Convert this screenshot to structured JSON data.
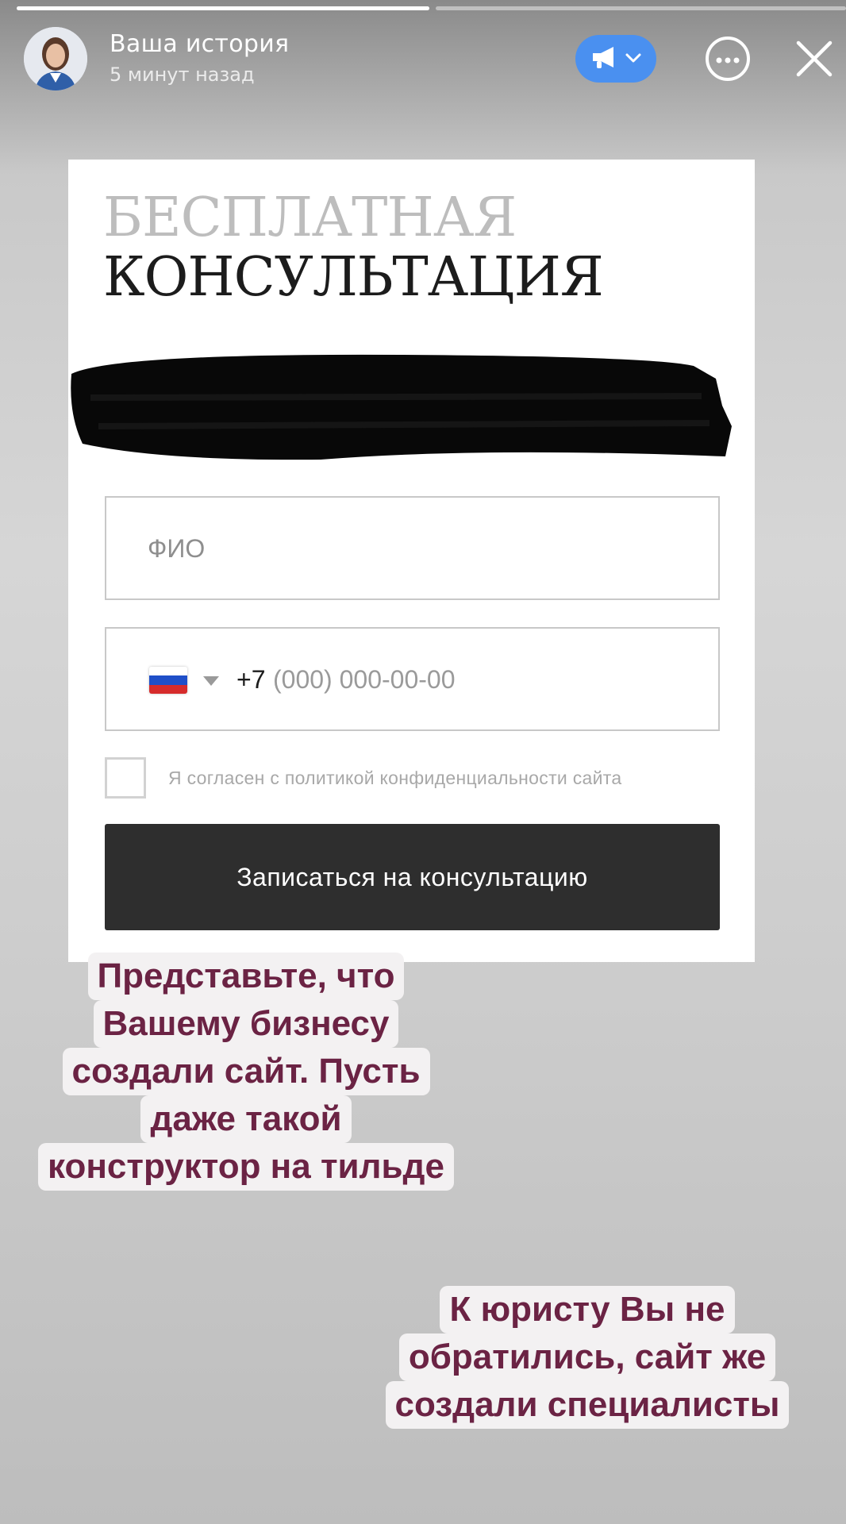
{
  "story": {
    "title": "Ваша история",
    "time": "5 минут назад"
  },
  "form": {
    "heading_line1": "БЕСПЛАТНАЯ",
    "heading_line2": "КОНСУЛЬТАЦИЯ",
    "name_placeholder": "ФИО",
    "phone_code": "+7",
    "phone_placeholder": "(000) 000-00-00",
    "consent_label": "Я согласен с политикой конфиденциальности сайта",
    "submit_label": "Записаться на консультацию"
  },
  "captions": {
    "caption1": [
      "Представьте, что",
      "Вашему бизнесу",
      "создали сайт. Пусть",
      "даже такой",
      "конструктор на тильде"
    ],
    "caption2": [
      "К юристу Вы не",
      "обратились, сайт же",
      "создали специалисты"
    ]
  },
  "colors": {
    "promo_button": "#4a90f0",
    "submit_button": "#2e2e2e",
    "caption_text": "#6b2344",
    "caption_bg": "#f3f1f2"
  },
  "progress": {
    "segments": 2,
    "first_fill_fraction": 1.0,
    "second_fill_fraction": 0.0
  },
  "icons": [
    "megaphone-icon",
    "chevron-down-icon",
    "more-icon",
    "close-icon"
  ]
}
